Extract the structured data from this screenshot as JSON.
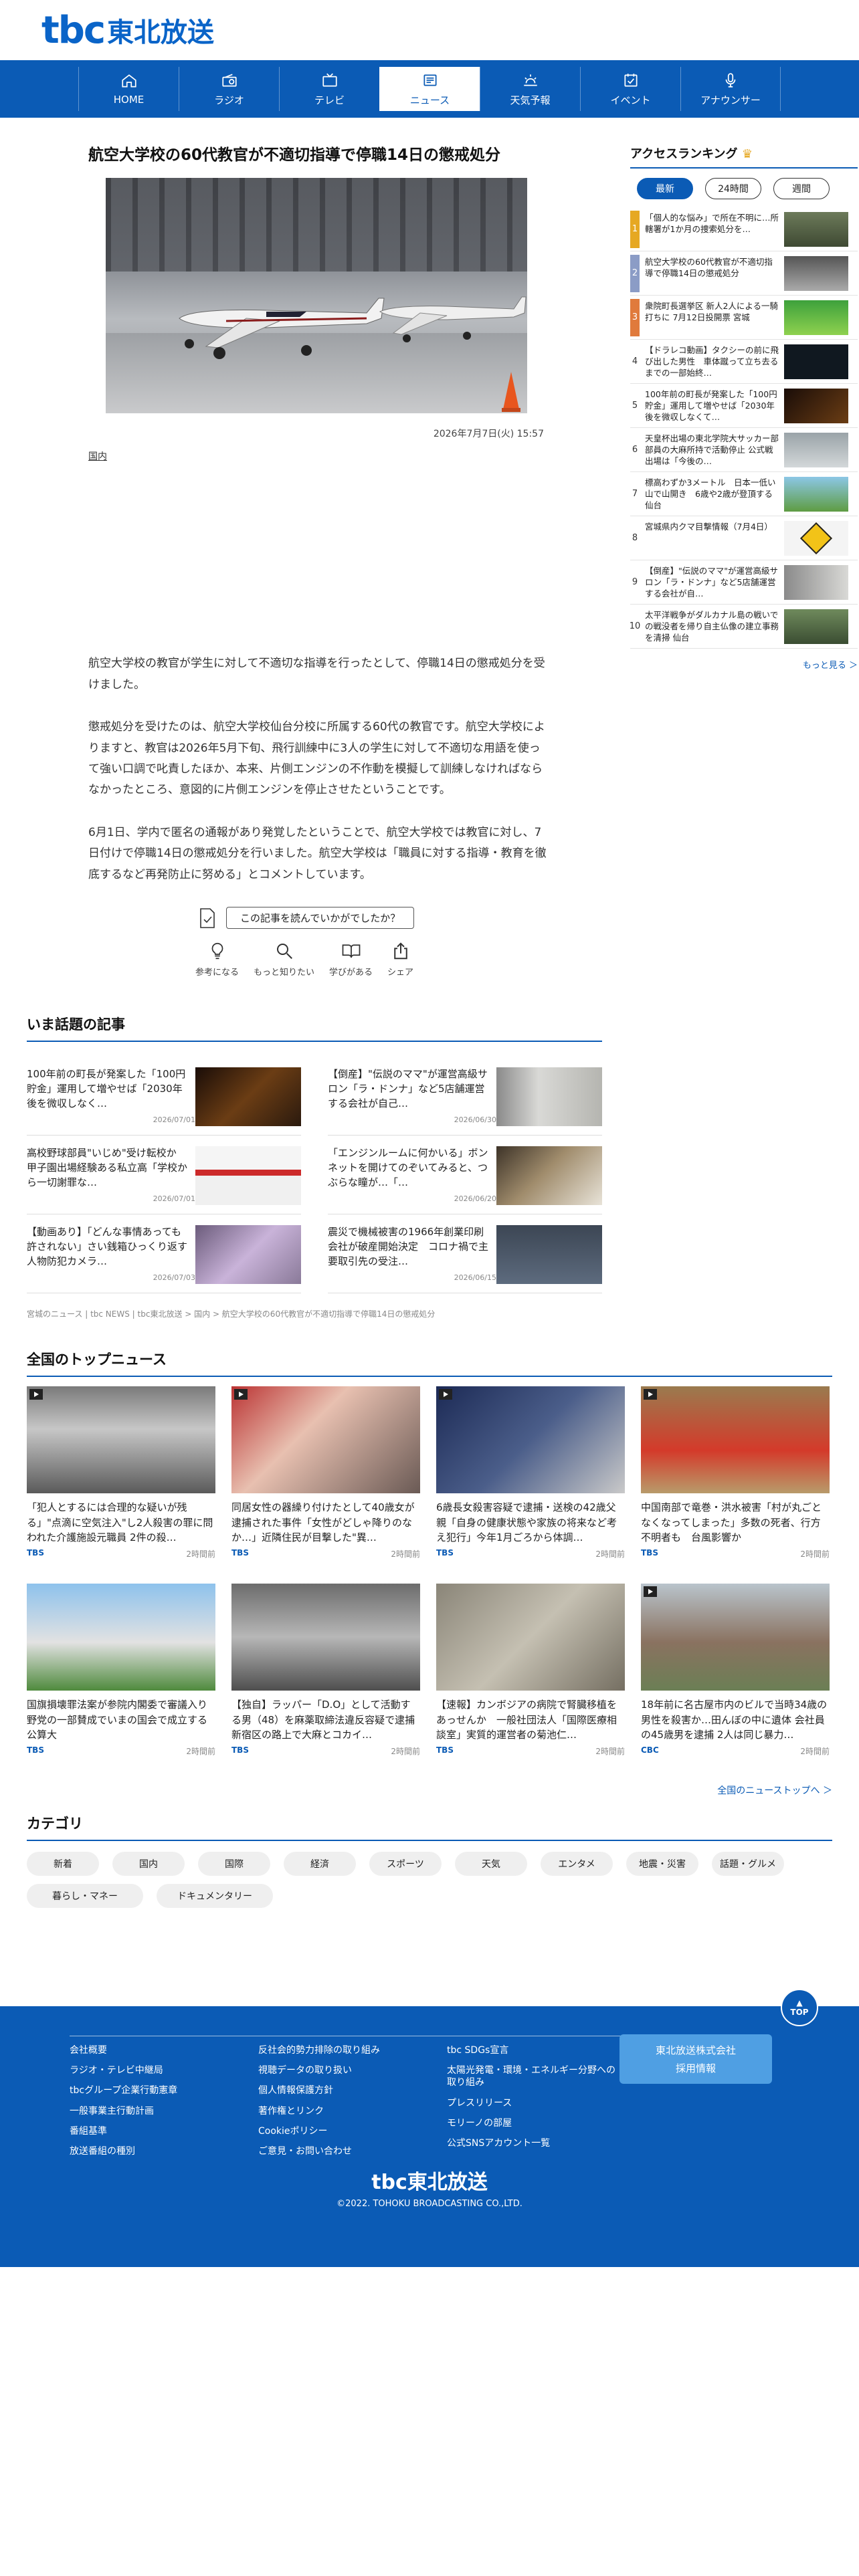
{
  "header": {
    "logo_tbc": "tbc",
    "logo_jp": "東北放送"
  },
  "nav": [
    {
      "label": "HOME",
      "icon": "home-icon"
    },
    {
      "label": "ラジオ",
      "icon": "radio-icon"
    },
    {
      "label": "テレビ",
      "icon": "tv-icon"
    },
    {
      "label": "ニュース",
      "icon": "news-icon",
      "active": true
    },
    {
      "label": "天気予報",
      "icon": "weather-icon"
    },
    {
      "label": "イベント",
      "icon": "event-icon"
    },
    {
      "label": "アナウンサー",
      "icon": "mic-icon"
    }
  ],
  "article": {
    "title": "航空大学校の60代教官が不適切指導で停職14日の懲戒処分",
    "date": "2026年7月7日(火) 15:57",
    "tag": "国内",
    "paragraphs": [
      "航空大学校の教官が学生に対して不適切な指導を行ったとして、停職14日の懲戒処分を受けました。",
      "懲戒処分を受けたのは、航空大学校仙台分校に所属する60代の教官です。航空大学校によりますと、教官は2026年5月下旬、飛行訓練中に3人の学生に対して不適切な用語を使って強い口調で叱責したほか、本来、片側エンジンの不作動を模擬して訓練しなければならなかったところ、意図的に片側エンジンを停止させたということです。",
      "6月1日、学内で匿名の通報があり発覚したということで、航空大学校では教官に対し、7日付けで停職14日の懲戒処分を行いました。航空大学校は「職員に対する指導・教育を徹底するなど再発防止に努める」とコメントしています。"
    ]
  },
  "survey": {
    "question": "この記事を読んでいかがでしたか？",
    "reactions": [
      {
        "label": "参考になる",
        "icon": "lightbulb-icon"
      },
      {
        "label": "もっと知りたい",
        "icon": "search-icon"
      },
      {
        "label": "学びがある",
        "icon": "book-icon"
      },
      {
        "label": "シェア",
        "icon": "share-icon"
      }
    ]
  },
  "hot": {
    "title": "いま話題の記事",
    "items": [
      {
        "text": "100年前の町長が発案した「100円貯金」運用して増やせば「2030年後を微収しなく…",
        "date": "2026/07/01"
      },
      {
        "text": "【倒産】\"伝説のママ\"が運営高級サロン「ラ・ドンナ」など5店舗運営する会社が自己…",
        "date": "2026/06/30"
      },
      {
        "text": "高校野球部員\"いじめ\"受け転校か　甲子園出場経験ある私立高「学校から一切謝罪な…",
        "date": "2026/07/01"
      },
      {
        "text": "「エンジンルームに何かいる」ボンネットを開けてのぞいてみると、つぶらな瞳が…「…",
        "date": "2026/06/20"
      },
      {
        "text": "【動画あり】「どんな事情あっても許されない」さい銭箱ひっくり返す人物防犯カメラ…",
        "date": "2026/07/03"
      },
      {
        "text": "震災で機械被害の1966年創業印刷会社が破産開始決定　コロナ禍で主要取引先の受注…",
        "date": "2026/06/15"
      }
    ]
  },
  "breadcrumb": "宮城のニュース | tbc NEWS | tbc東北放送 > 国内 > 航空大学校の60代教官が不適切指導で停職14日の懲戒処分",
  "top_news": {
    "title": "全国のトップニュース",
    "more": "全国のニューストップへ ＞",
    "items": [
      {
        "text": "「犯人とするには合理的な疑いが残る」\"点滴に空気注入\"し2人殺害の罪に問われた介護施設元職員 2件の殺…",
        "src": "TBS",
        "ago": "2時間前"
      },
      {
        "text": "同居女性の器繰り付けたとして40歳女が逮捕された事件「女性がどしゃ降りのなか…」近隣住民が目撃した\"異…",
        "src": "TBS",
        "ago": "2時間前"
      },
      {
        "text": "6歳長女殺害容疑で逮捕・送検の42歳父親「自身の健康状態や家族の将来など考え犯行」今年1月ごろから体調…",
        "src": "TBS",
        "ago": "2時間前"
      },
      {
        "text": "中国南部で竜巻・洪水被害「村が丸ごとなくなってしまった」多数の死者、行方不明者も　台風影響か",
        "src": "TBS",
        "ago": "2時間前"
      },
      {
        "text": "国旗損壊罪法案が参院内閣委で審議入り　野党の一部賛成でいまの国会で成立する公算大",
        "src": "TBS",
        "ago": "2時間前"
      },
      {
        "text": "【独自】ラッパー「D.O」として活動する男（48）を麻薬取締法違反容疑で逮捕　新宿区の路上で大麻とコカイ…",
        "src": "TBS",
        "ago": "2時間前"
      },
      {
        "text": "【速報】カンボジアの病院で腎臓移植をあっせんか　一般社団法人「国際医療相談室」実質的運営者の菊池仁…",
        "src": "TBS",
        "ago": "2時間前"
      },
      {
        "text": "18年前に名古屋市内のビルで当時34歳の男性を殺害か…田んぼの中に遺体 会社員の45歳男を逮捕 2人は同じ暴力…",
        "src": "CBC",
        "ago": "2時間前"
      }
    ]
  },
  "categories": {
    "title": "カテゴリ",
    "items": [
      "新着",
      "国内",
      "国際",
      "経済",
      "スポーツ",
      "天気",
      "エンタメ",
      "地震・災害",
      "話題・グルメ",
      "暮らし・マネー",
      "ドキュメンタリー"
    ]
  },
  "ranking": {
    "title": "アクセスランキング",
    "tabs": [
      "最新",
      "24時間",
      "週間"
    ],
    "more": "もっと見る ＞",
    "items": [
      {
        "text": "「個人的な悩み」で所在不明に…所轄署が1か月の捜索処分を…"
      },
      {
        "text": "航空大学校の60代教官が不適切指導で停職14日の懲戒処分"
      },
      {
        "text": "衆院町長選挙区 新人2人による一騎打ちに 7月12日投開票 宮城"
      },
      {
        "text": "【ドラレコ動画】タクシーの前に飛び出した男性　車体蹴って立ち去るまでの一部始終…"
      },
      {
        "text": "100年前の町長が発案した「100円貯金」運用して増やせば「2030年後を微収しなくて…"
      },
      {
        "text": "天皇杯出場の東北学院大サッカー部 部員の大麻所持で活動停止 公式戦出場は「今後の…"
      },
      {
        "text": "標高わずか3メートル　日本一低い山で山開き　6歳や2歳が登頂する仙台"
      },
      {
        "text": "宮城県内クマ目撃情報（7月4日）"
      },
      {
        "text": "【倒産】\"伝説のママ\"が運営高級サロン「ラ・ドンナ」など5店舗運営する会社が自…"
      },
      {
        "text": "太平洋戦争がダルカナル島の戦いでの戦没者を帰り自主仏像の建立事務を清掃 仙台"
      }
    ]
  },
  "footer": {
    "top_label": "TOP",
    "col1": [
      "会社概要",
      "ラジオ・テレビ中継局",
      "tbcグループ企業行動憲章",
      "一般事業主行動計画",
      "番組基準",
      "放送番組の種別"
    ],
    "col2": [
      "反社会的勢力排除の取り組み",
      "視聴データの取り扱い",
      "個人情報保護方針",
      "著作権とリンク",
      "Cookieポリシー",
      "ご意見・お問い合わせ"
    ],
    "col3": [
      "tbc SDGs宣言",
      "太陽光発電・環境・エネルギー分野への取り組み",
      "プレスリリース",
      "モリーノの部屋",
      "公式SNSアカウント一覧"
    ],
    "recruit_l1": "東北放送株式会社",
    "recruit_l2": "採用情報",
    "logo": "tbc東北放送",
    "copyright": "©2022. TOHOKU BROADCASTING CO.,LTD."
  }
}
